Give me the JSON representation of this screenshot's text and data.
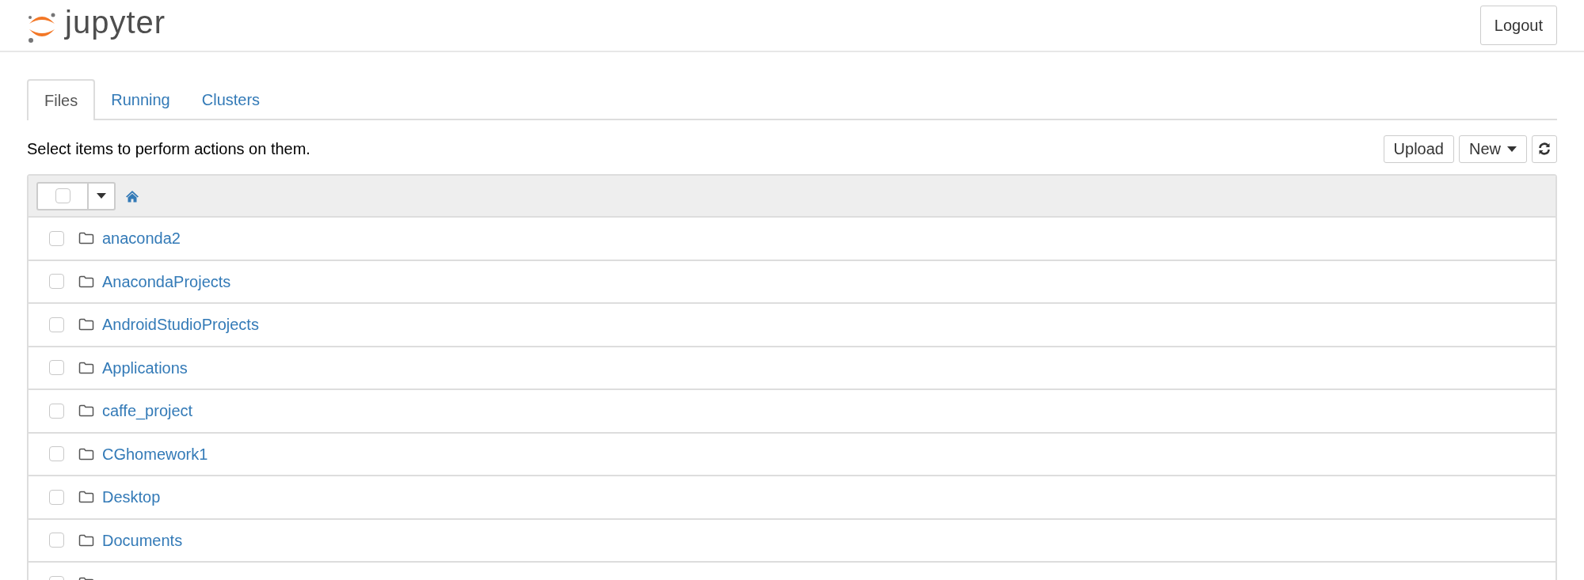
{
  "header": {
    "logo_text": "jupyter",
    "logout": "Logout"
  },
  "tabs": [
    {
      "label": "Files",
      "selected": true
    },
    {
      "label": "Running",
      "selected": false
    },
    {
      "label": "Clusters",
      "selected": false
    }
  ],
  "toolbar": {
    "hint": "Select items to perform actions on them.",
    "buttons": [
      {
        "kind": "text",
        "label": "Upload"
      },
      {
        "kind": "dropdown",
        "label": "New"
      },
      {
        "kind": "refresh"
      }
    ]
  },
  "list_header": {
    "select_all_checked": false
  },
  "items": [
    {
      "name": "anaconda2",
      "checked": false
    },
    {
      "name": "AnacondaProjects",
      "checked": false
    },
    {
      "name": "AndroidStudioProjects",
      "checked": false
    },
    {
      "name": "Applications",
      "checked": false
    },
    {
      "name": "caffe_project",
      "checked": false
    },
    {
      "name": "CGhomework1",
      "checked": false
    },
    {
      "name": "Desktop",
      "checked": false
    },
    {
      "name": "Documents",
      "checked": false
    },
    {
      "checked": false
    }
  ]
}
